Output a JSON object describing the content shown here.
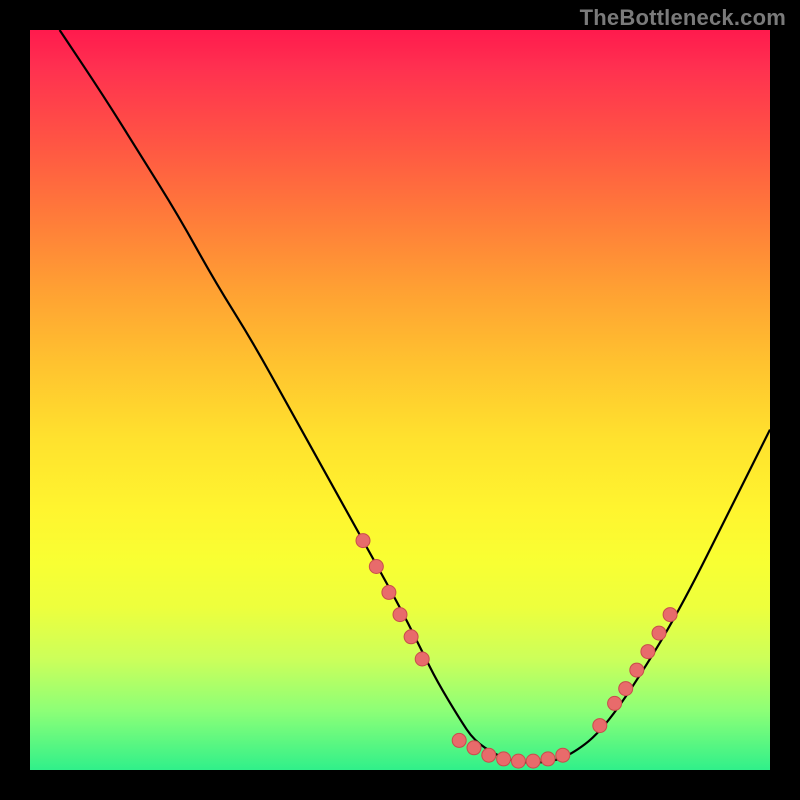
{
  "watermark": "TheBottleneck.com",
  "colors": {
    "background": "#000000",
    "curve": "#000000",
    "dot_fill": "#e86b6b",
    "dot_stroke": "#c94c4c",
    "watermark_text": "#7a7a7a"
  },
  "chart_data": {
    "type": "line",
    "title": "",
    "xlabel": "",
    "ylabel": "",
    "xlim": [
      0,
      100
    ],
    "ylim": [
      0,
      100
    ],
    "grid": false,
    "legend": false,
    "series": [
      {
        "name": "bottleneck-curve",
        "x": [
          4,
          10,
          15,
          20,
          25,
          30,
          35,
          40,
          45,
          50,
          53,
          55,
          58,
          60,
          63,
          66,
          70,
          73,
          77,
          82,
          88,
          95,
          100
        ],
        "y": [
          100,
          91,
          83,
          75,
          66,
          58,
          49,
          40,
          31,
          22,
          16,
          12,
          7,
          4,
          2,
          1,
          1,
          2,
          5,
          12,
          22,
          36,
          46
        ]
      }
    ],
    "markers": [
      {
        "name": "left-branch-dots",
        "x": [
          45.0,
          46.8,
          48.5,
          50.0,
          51.5,
          53.0
        ],
        "y": [
          31,
          27.5,
          24,
          21,
          18,
          15
        ]
      },
      {
        "name": "valley-dots",
        "x": [
          58,
          60,
          62,
          64,
          66,
          68,
          70,
          72
        ],
        "y": [
          4,
          3,
          2,
          1.5,
          1.2,
          1.2,
          1.5,
          2
        ]
      },
      {
        "name": "right-branch-dots",
        "x": [
          77,
          79,
          80.5,
          82,
          83.5,
          85.0,
          86.5
        ],
        "y": [
          6,
          9,
          11,
          13.5,
          16,
          18.5,
          21
        ]
      }
    ]
  }
}
